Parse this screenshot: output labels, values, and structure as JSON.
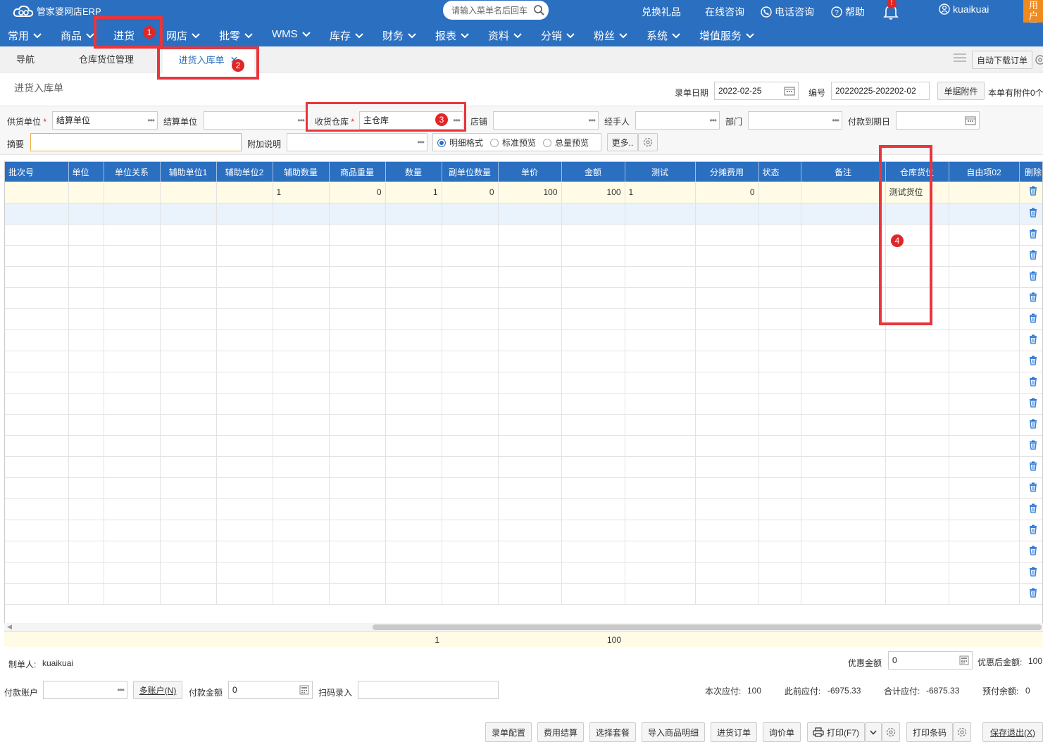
{
  "app": {
    "logo_text": "管家婆网店ERP"
  },
  "header": {
    "search_placeholder": "请输入菜单名后回车",
    "links": [
      "兑换礼品",
      "在线咨询",
      "电话咨询",
      "帮助"
    ],
    "notification_badge": "!",
    "user": "kuaikuai",
    "corner_text": "用户互动"
  },
  "menu": {
    "items": [
      "常用",
      "商品",
      "进货",
      "网店",
      "批零",
      "WMS",
      "库存",
      "财务",
      "报表",
      "资料",
      "分销",
      "粉丝",
      "系统",
      "增值服务"
    ],
    "active_badge": "1"
  },
  "tabs": {
    "items": [
      "导航",
      "仓库货位管理",
      "进货入库单"
    ],
    "active_badge": "2",
    "right_button": "自动下载订单"
  },
  "form": {
    "title": "进货入库单",
    "date_label": "录单日期",
    "date_value": "2022-02-25",
    "number_label": "编号",
    "number_value": "20220225-202202-02",
    "attach_button": "单据附件",
    "attach_info": "本单有附件0个",
    "supplier_label": "供货单位",
    "supplier_value": "结算单位",
    "settle_label": "结算单位",
    "settle_value": "",
    "warehouse_label": "收货仓库",
    "warehouse_value": "主仓库",
    "warehouse_badge": "3",
    "shop_label": "店铺",
    "handler_label": "经手人",
    "dept_label": "部门",
    "due_label": "付款到期日",
    "summary_label": "摘要",
    "note_label": "附加说明",
    "radio_options": [
      "明细格式",
      "标准预览",
      "总量预览"
    ],
    "more_button": "更多.."
  },
  "grid": {
    "columns": [
      "批次号",
      "单位",
      "单位关系",
      "辅助单位1",
      "辅助单位2",
      "辅助数量",
      "商品重量",
      "数量",
      "副单位数量",
      "单价",
      "金额",
      "测试",
      "分摊费用",
      "状态",
      "备注",
      "仓库货位",
      "自由项02",
      "删除"
    ],
    "rows": [
      {
        "辅助数量": "1",
        "商品重量": "0",
        "数量": "1",
        "副单位数量": "0",
        "单价": "100",
        "金额": "100",
        "测试": "1",
        "分摊费用": "0",
        "仓库货位": "测试货位"
      }
    ],
    "column_badge": "4",
    "totals": {
      "数量": "1",
      "金额": "100"
    }
  },
  "footer": {
    "creator_label": "制单人:",
    "creator_value": "kuaikuai",
    "discount_label": "优惠金额",
    "discount_value": "0",
    "after_discount_label": "优惠后金额:",
    "after_discount_value": "100",
    "pay_account_label": "付款账户",
    "multi_account_button": "多账户(N)",
    "pay_amount_label": "付款金额",
    "pay_amount_value": "0",
    "scan_label": "扫码录入",
    "current_payable_label": "本次应付:",
    "current_payable_value": "100",
    "prev_payable_label": "此前应付:",
    "prev_payable_value": "-6975.33",
    "total_payable_label": "合计应付:",
    "total_payable_value": "-6875.33",
    "prepaid_label": "预付余额:",
    "prepaid_value": "0",
    "buttons": [
      "录单配置",
      "费用结算",
      "选择套餐",
      "导入商品明细",
      "进货订单",
      "询价单",
      "打印(F7)",
      "打印条码",
      "保存退出(X)"
    ]
  },
  "colors": {
    "primary": "#2b6fc0",
    "highlight_box": "#e8363c",
    "row_yellow": "#fffbe6",
    "row_blue": "#eaf2fb"
  }
}
